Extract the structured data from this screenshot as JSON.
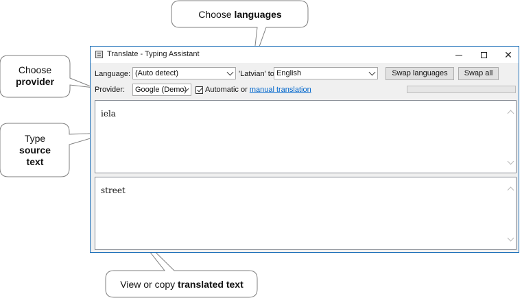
{
  "callouts": {
    "languages": {
      "pre": "Choose ",
      "bold": "languages"
    },
    "provider": {
      "line1": "Choose",
      "bold": "provider"
    },
    "source": {
      "line1": "Type",
      "bold1": "source",
      "bold2": "text"
    },
    "translated": {
      "pre": "View or copy ",
      "bold": "translated text"
    }
  },
  "window": {
    "title": "Translate - Typing Assistant",
    "controls": {
      "minimize": "minimize-icon",
      "maximize": "maximize-icon",
      "close": "close-icon",
      "close_glyph": "✕"
    }
  },
  "toolbar": {
    "language_label": "Language:",
    "source_language": "(Auto detect)",
    "detected_label": "'Latvian' to",
    "target_language": "English",
    "swap_languages_label": "Swap languages",
    "swap_all_label": "Swap all",
    "provider_label": "Provider:",
    "provider_value": "Google (Demo)",
    "automatic_checked": true,
    "automatic_label": "Automatic or",
    "manual_link": "manual translation",
    "progress_fraction": 0.0
  },
  "source_text": "iela",
  "translated_text": "street",
  "colors": {
    "accent": "#1c6fb8",
    "link": "#0066cc"
  }
}
